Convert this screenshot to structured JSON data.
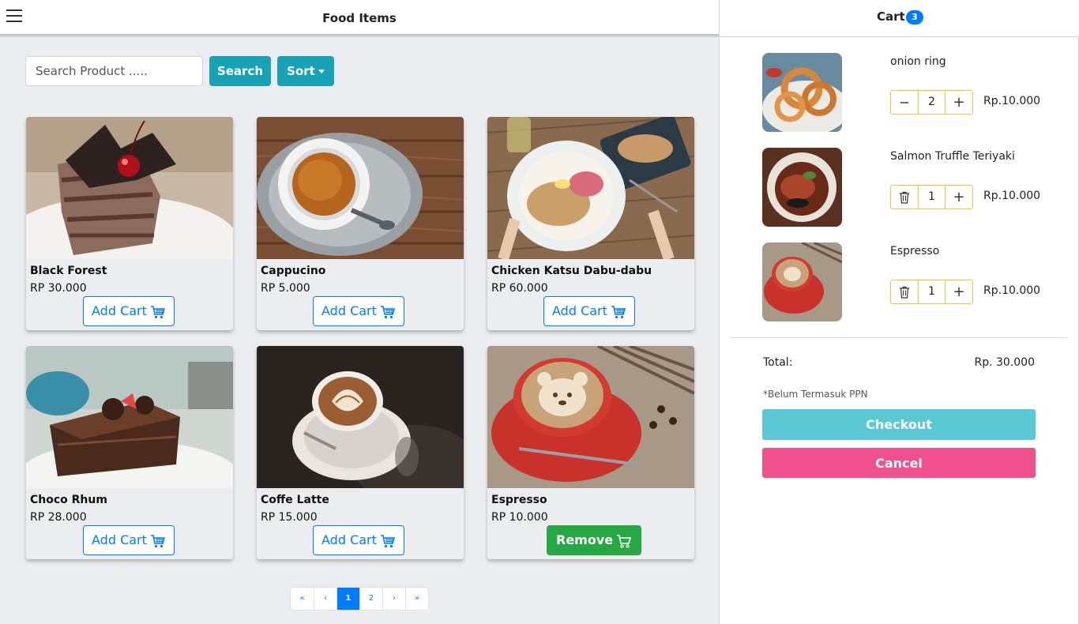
{
  "header": {
    "title": "Food Items",
    "menu_icon": "hamburger-menu-icon"
  },
  "toolbar": {
    "search_placeholder": "Search Product .....",
    "search_label": "Search",
    "sort_label": "Sort"
  },
  "products": [
    {
      "name": "Black Forest",
      "price": "RP 30.000",
      "button": "Add Cart",
      "in_cart": false
    },
    {
      "name": "Cappucino",
      "price": "RP 5.000",
      "button": "Add Cart",
      "in_cart": false
    },
    {
      "name": "Chicken Katsu Dabu-dabu",
      "price": "RP 60.000",
      "button": "Add Cart",
      "in_cart": false
    },
    {
      "name": "Choco Rhum",
      "price": "RP 28.000",
      "button": "Add Cart",
      "in_cart": false
    },
    {
      "name": "Coffe Latte",
      "price": "RP 15.000",
      "button": "Add Cart",
      "in_cart": false
    },
    {
      "name": "Espresso",
      "price": "RP 10.000",
      "button": "Remove",
      "in_cart": true
    }
  ],
  "pagination": {
    "first": "«",
    "prev": "‹",
    "pages": [
      "1",
      "2"
    ],
    "current": "1",
    "next": "›",
    "last": "»"
  },
  "cart": {
    "title": "Cart",
    "badge": "3",
    "items": [
      {
        "name": "onion ring",
        "qty": "2",
        "price": "Rp.10.000",
        "left_action": "minus-icon",
        "plus": "+"
      },
      {
        "name": "Salmon Truffle Teriyaki",
        "qty": "1",
        "price": "Rp.10.000",
        "left_action": "trash-icon",
        "plus": "+"
      },
      {
        "name": "Espresso",
        "qty": "1",
        "price": "Rp.10.000",
        "left_action": "trash-icon",
        "plus": "+"
      }
    ],
    "total_label": "Total:",
    "total_value": "Rp. 30.000",
    "ppn_note": "*Belum Termasuk PPN",
    "checkout_label": "Checkout",
    "cancel_label": "Cancel"
  },
  "colors": {
    "primary": "#007bff",
    "info": "#17a2b8",
    "success": "#28a745",
    "checkout": "#5bc8d6",
    "cancel": "#f0508b",
    "stepper_border": "#f0c040"
  }
}
